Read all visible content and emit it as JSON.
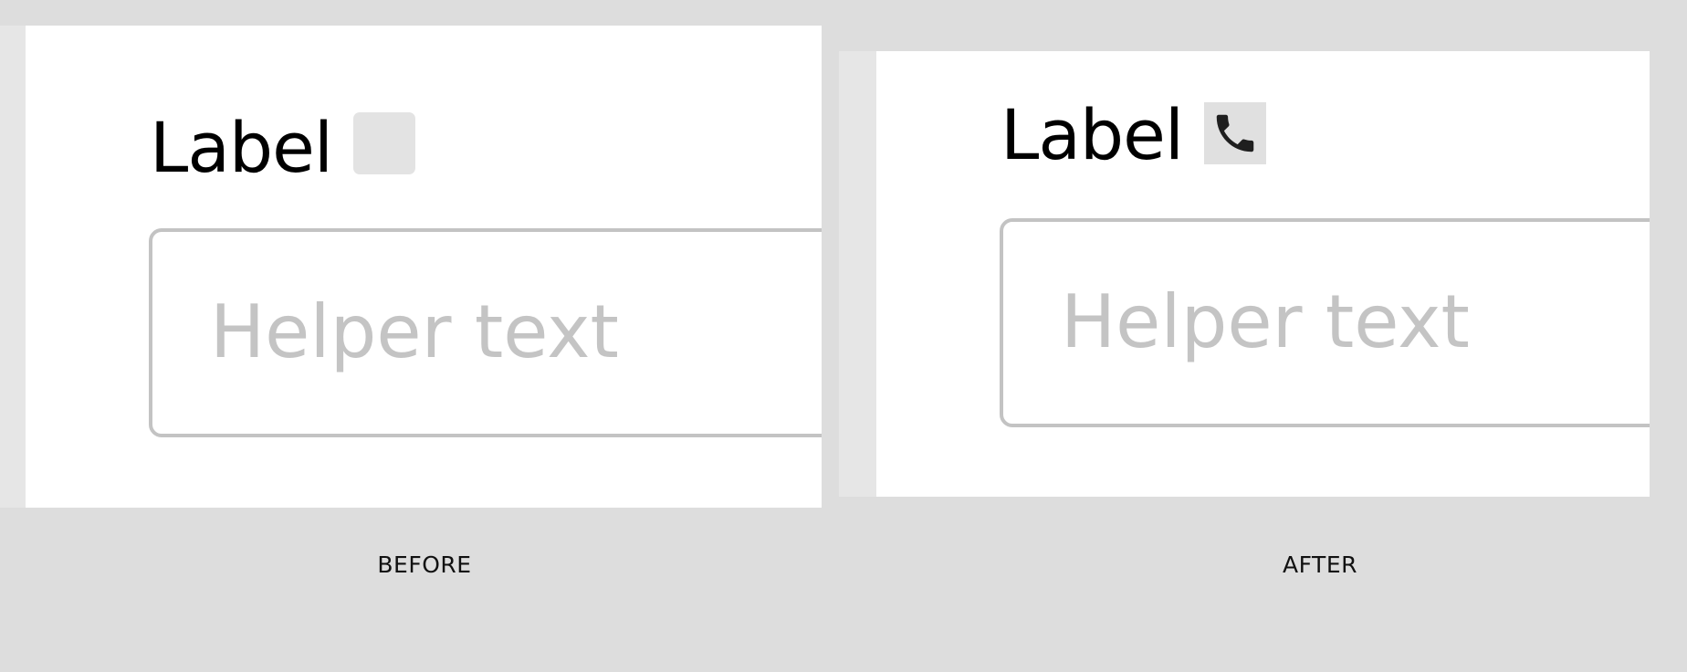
{
  "before": {
    "label": "Label",
    "icon": "empty-icon-placeholder",
    "input_placeholder": "Helper text",
    "caption": "BEFORE"
  },
  "after": {
    "label": "Label",
    "icon": "phone-icon",
    "input_placeholder": "Helper text",
    "caption": "AFTER"
  },
  "colors": {
    "background": "#dddddd",
    "panel": "#ffffff",
    "label_text": "#000000",
    "helper_text": "#c4c4c4",
    "input_border": "#c3c3c3",
    "icon_slot": "#e3e3e3",
    "icon_fill": "#1f1f1f"
  }
}
